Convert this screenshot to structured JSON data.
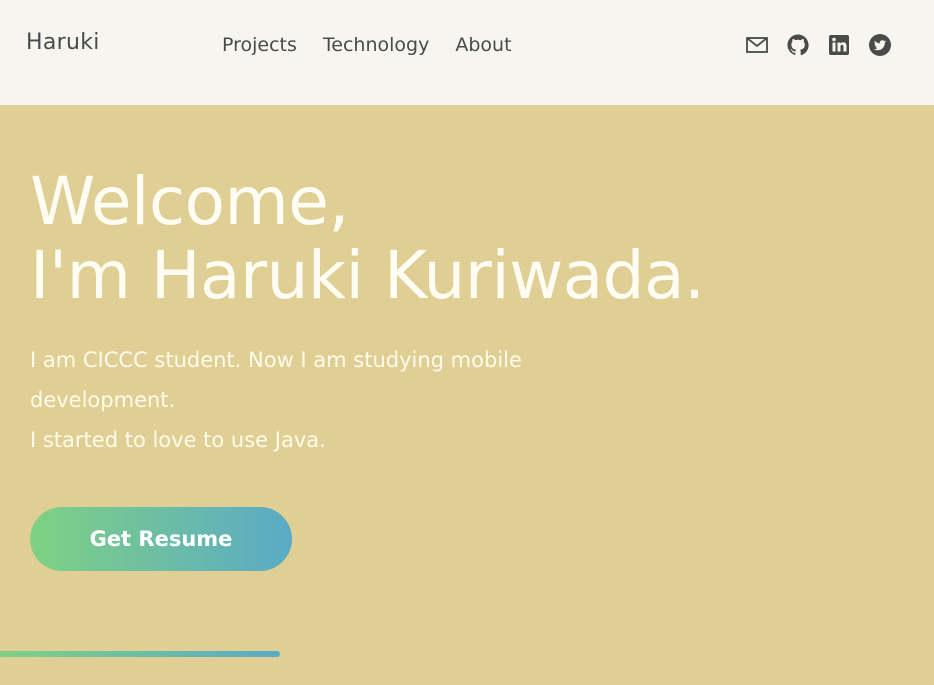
{
  "header": {
    "logo": "Haruki",
    "nav": [
      {
        "label": "Projects"
      },
      {
        "label": "Technology"
      },
      {
        "label": "About"
      }
    ],
    "social_icons": [
      "mail-icon",
      "github-icon",
      "linkedin-icon",
      "twitter-icon"
    ]
  },
  "hero": {
    "title_line1": "Welcome,",
    "title_line2": "I'm Haruki Kuriwada.",
    "desc_line1": "I am CICCC student. Now I am studying mobile development.",
    "desc_line2": "I started to love to use Java.",
    "button_label": "Get Resume"
  },
  "scroll_progress": 0.3,
  "colors": {
    "header_bg": "#f6f5ef",
    "hero_bg": "#e0cf94",
    "text_dark": "#4a4a4a",
    "text_light": "#fffdf3",
    "gradient_start": "#7fd183",
    "gradient_end": "#5aaac6"
  }
}
